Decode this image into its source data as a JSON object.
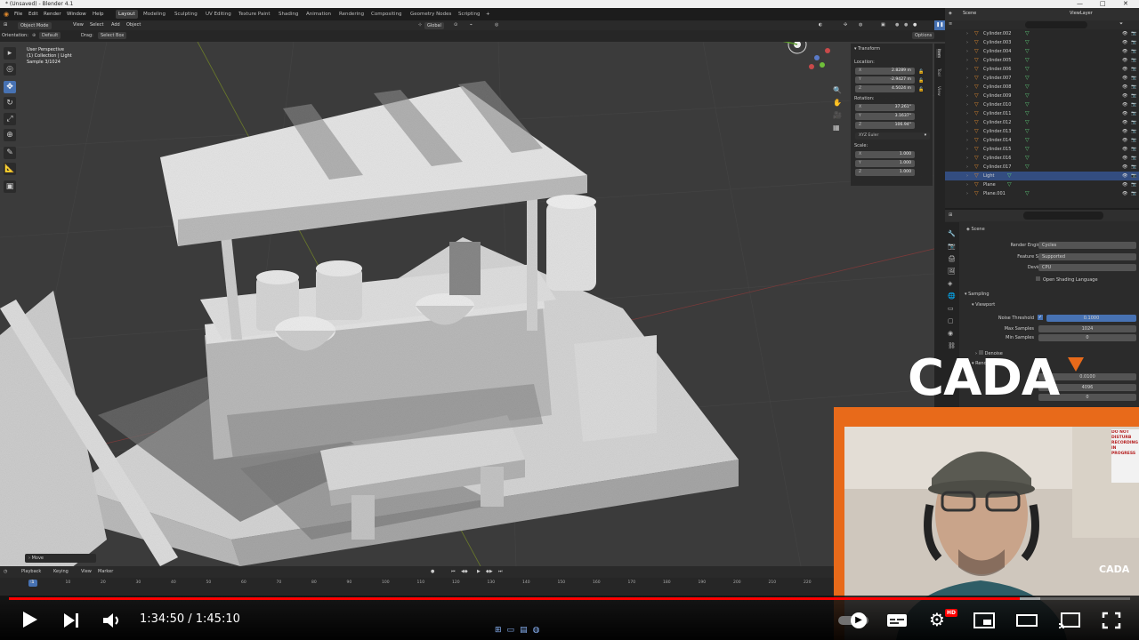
{
  "window": {
    "title": "* (Unsaved) - Blender 4.1",
    "controls": [
      "—",
      "□",
      "✕"
    ]
  },
  "menu": {
    "items": [
      "File",
      "Edit",
      "Render",
      "Window",
      "Help"
    ],
    "workspaces": [
      "Layout",
      "Modeling",
      "Sculpting",
      "UV Editing",
      "Texture Paint",
      "Shading",
      "Animation",
      "Rendering",
      "Compositing",
      "Geometry Nodes",
      "Scripting"
    ],
    "active_workspace": "Layout",
    "add_tab": "+",
    "scene": "Scene",
    "view_layer": "ViewLayer"
  },
  "viewport_header": {
    "mode": "Object Mode",
    "menus": [
      "View",
      "Select",
      "Add",
      "Object"
    ],
    "transform_orientation": "Global",
    "orientation_label": "Orientation:",
    "orientation_value": "Default",
    "drag_label": "Drag:",
    "drag_value": "Select Box",
    "options": "Options"
  },
  "viewport_info": {
    "line1": "User Perspective",
    "line2": "(1) Collection | Light",
    "line3": "Sample 3/1024"
  },
  "last_operator": "Move",
  "n_panel": {
    "section": "Transform",
    "location_label": "Location:",
    "location": [
      {
        "axis": "X",
        "value": "2.8289 m"
      },
      {
        "axis": "Y",
        "value": "-2.9427 m"
      },
      {
        "axis": "Z",
        "value": "4.5024 m"
      }
    ],
    "rotation_label": "Rotation:",
    "rotation": [
      {
        "axis": "X",
        "value": "37.261°"
      },
      {
        "axis": "Y",
        "value": "3.1637°"
      },
      {
        "axis": "Z",
        "value": "106.94°"
      }
    ],
    "rotation_mode": "XYZ Euler",
    "scale_label": "Scale:",
    "scale": [
      {
        "axis": "X",
        "value": "1.000"
      },
      {
        "axis": "Y",
        "value": "1.000"
      },
      {
        "axis": "Z",
        "value": "1.000"
      }
    ],
    "tabs": [
      "Item",
      "Tool",
      "View"
    ]
  },
  "outliner": {
    "rows": [
      {
        "name": "Cylinder.002",
        "selected": false
      },
      {
        "name": "Cylinder.003",
        "selected": false
      },
      {
        "name": "Cylinder.004",
        "selected": false
      },
      {
        "name": "Cylinder.005",
        "selected": false
      },
      {
        "name": "Cylinder.006",
        "selected": false
      },
      {
        "name": "Cylinder.007",
        "selected": false
      },
      {
        "name": "Cylinder.008",
        "selected": false
      },
      {
        "name": "Cylinder.009",
        "selected": false
      },
      {
        "name": "Cylinder.010",
        "selected": false
      },
      {
        "name": "Cylinder.011",
        "selected": false
      },
      {
        "name": "Cylinder.012",
        "selected": false
      },
      {
        "name": "Cylinder.013",
        "selected": false
      },
      {
        "name": "Cylinder.014",
        "selected": false
      },
      {
        "name": "Cylinder.015",
        "selected": false
      },
      {
        "name": "Cylinder.016",
        "selected": false
      },
      {
        "name": "Cylinder.017",
        "selected": false
      },
      {
        "name": "Light",
        "selected": true
      },
      {
        "name": "Plane",
        "selected": false
      },
      {
        "name": "Plane.001",
        "selected": false
      }
    ]
  },
  "properties": {
    "context": "Scene",
    "render_engine_label": "Render Engine",
    "render_engine": "Cycles",
    "feature_set_label": "Feature Set",
    "feature_set": "Supported",
    "device_label": "Device",
    "device": "CPU",
    "osl_label": "Open Shading Language",
    "sampling": "Sampling",
    "viewport": "Viewport",
    "noise_threshold_label": "Noise Threshold",
    "noise_threshold": "0.1000",
    "max_samples_label": "Max Samples",
    "max_samples": "1024",
    "min_samples_label": "Min Samples",
    "min_samples": "0",
    "denoise": "Denoise",
    "render": "Render",
    "render_noise_threshold": "0.0100",
    "render_max_samples": "4096",
    "render_min_samples": "0"
  },
  "timeline": {
    "menus": [
      "Playback",
      "Keying",
      "View",
      "Marker"
    ],
    "current_frame": "1",
    "ticks": [
      "0",
      "10",
      "20",
      "30",
      "40",
      "50",
      "60",
      "70",
      "80",
      "90",
      "100",
      "110",
      "120",
      "130",
      "140",
      "150",
      "160",
      "170",
      "180",
      "190",
      "200",
      "210",
      "220"
    ]
  },
  "video": {
    "current_time": "1:34:50",
    "duration": "1:45:10",
    "time_display": "1:34:50 / 1:45:10",
    "progress": 0.9017,
    "buffered": 0.92,
    "hd_badge": "HD"
  },
  "overlay": {
    "brand": "CADA",
    "brand_small": "CADA",
    "sign_text": "DO NOT DISTURB RECORDING IN PROGRESS"
  },
  "colors": {
    "blender_selection": "#4772b3",
    "outliner_selected": "#334d80",
    "object_icon": "#e0892d",
    "mesh_data": "#5fcf7a",
    "youtube_red": "#ff0000",
    "brand_orange": "#e86a1a"
  }
}
